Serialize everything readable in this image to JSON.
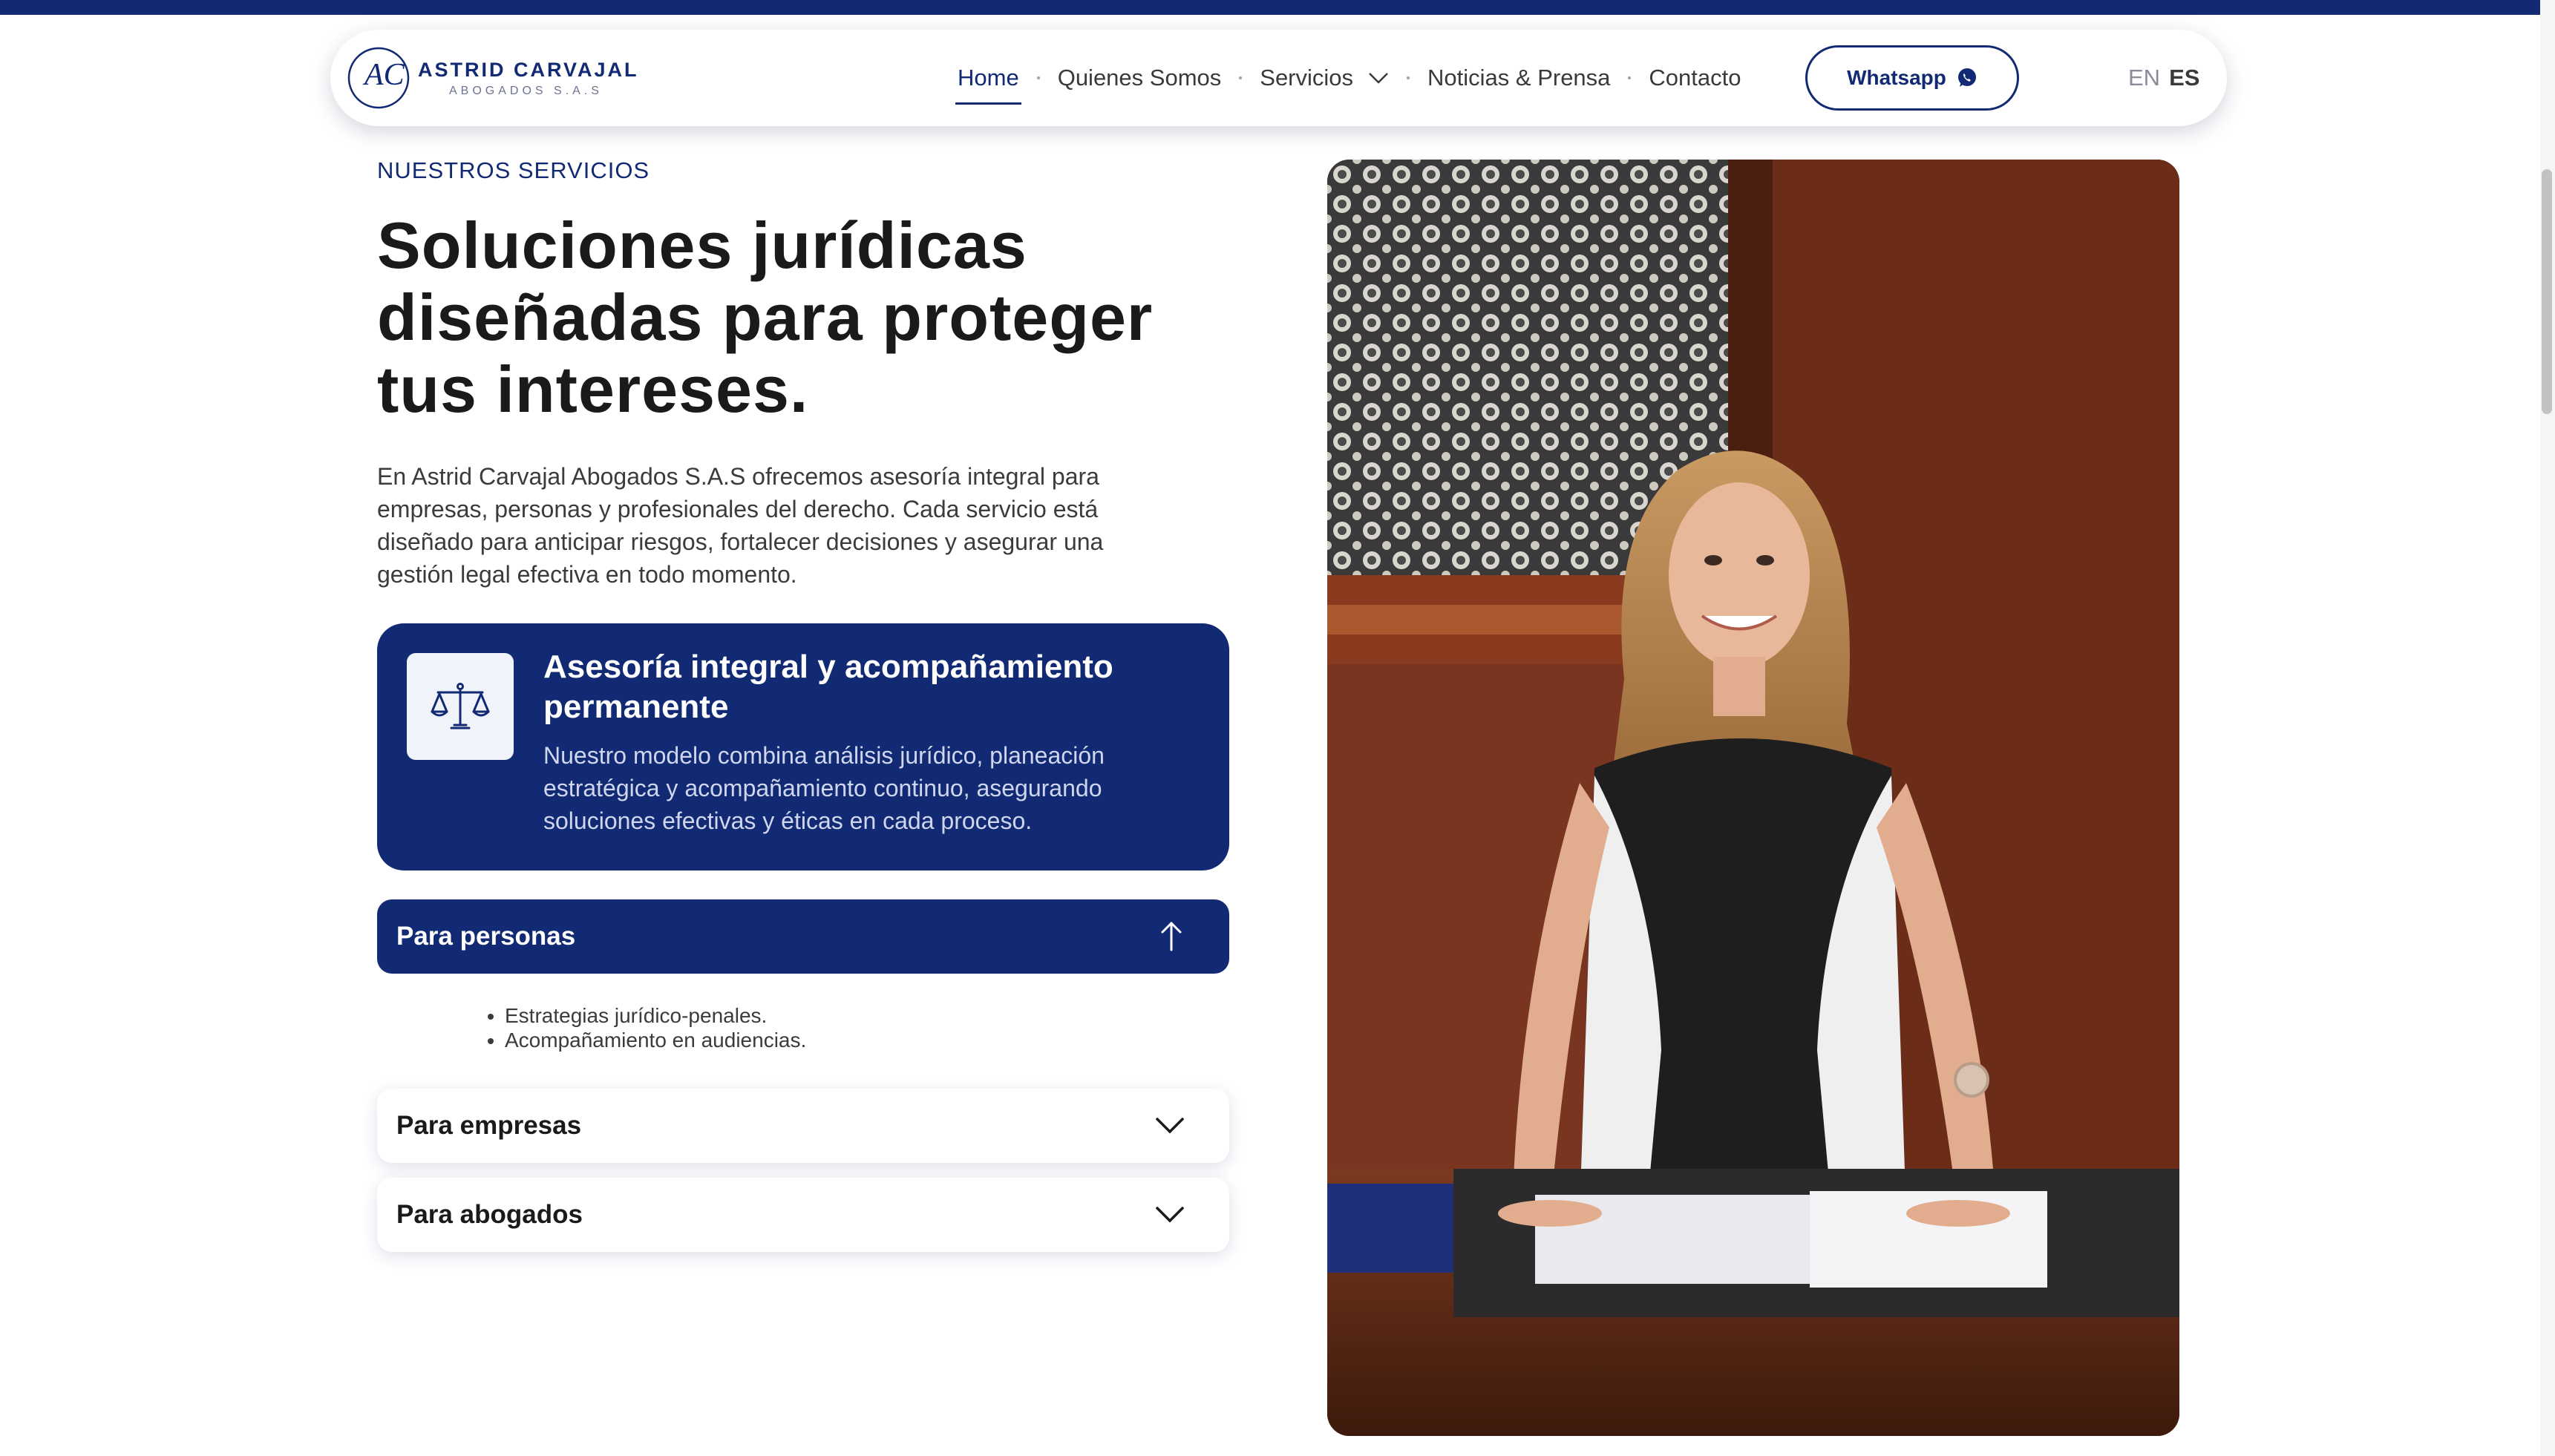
{
  "brand": {
    "initials": "AC",
    "name": "ASTRID CARVAJAL",
    "subtitle": "ABOGADOS S.A.S",
    "primary_color": "#122a73"
  },
  "nav": {
    "items": [
      {
        "label": "Home",
        "active": true
      },
      {
        "label": "Quienes Somos"
      },
      {
        "label": "Servicios",
        "has_dropdown": true
      },
      {
        "label": "Noticias & Prensa"
      },
      {
        "label": "Contacto"
      }
    ],
    "whatsapp_label": "Whatsapp",
    "lang_en": "EN",
    "lang_es": "ES",
    "active_lang": "ES"
  },
  "services": {
    "eyebrow": "NUESTROS SERVICIOS",
    "headline_line1": "Soluciones jurídicas",
    "headline_line2": "diseñadas para proteger",
    "headline_line3": "tus intereses.",
    "intro_line1": "En Astrid Carvajal Abogados S.A.S ofrecemos asesoría integral para",
    "intro_line2": "empresas, personas y profesionales del derecho. Cada servicio está",
    "intro_line3": "diseñado para anticipar riesgos, fortalecer decisiones y asegurar una",
    "intro_line4": "gestión legal efectiva en todo momento.",
    "feature": {
      "icon": "scale-icon",
      "title_line1": "Asesoría integral y acompañamiento",
      "title_line2": "permanente",
      "text_line1": "Nuestro modelo combina análisis jurídico, planeación",
      "text_line2": "estratégica y acompañamiento continuo, asegurando",
      "text_line3": "soluciones efectivas y éticas en cada proceso."
    },
    "accordion": [
      {
        "label": "Para personas",
        "expanded": true,
        "items": [
          "Estrategias jurídico-penales.",
          "Acompañamiento en audiencias."
        ]
      },
      {
        "label": "Para empresas",
        "expanded": false
      },
      {
        "label": "Para abogados",
        "expanded": false
      }
    ]
  }
}
